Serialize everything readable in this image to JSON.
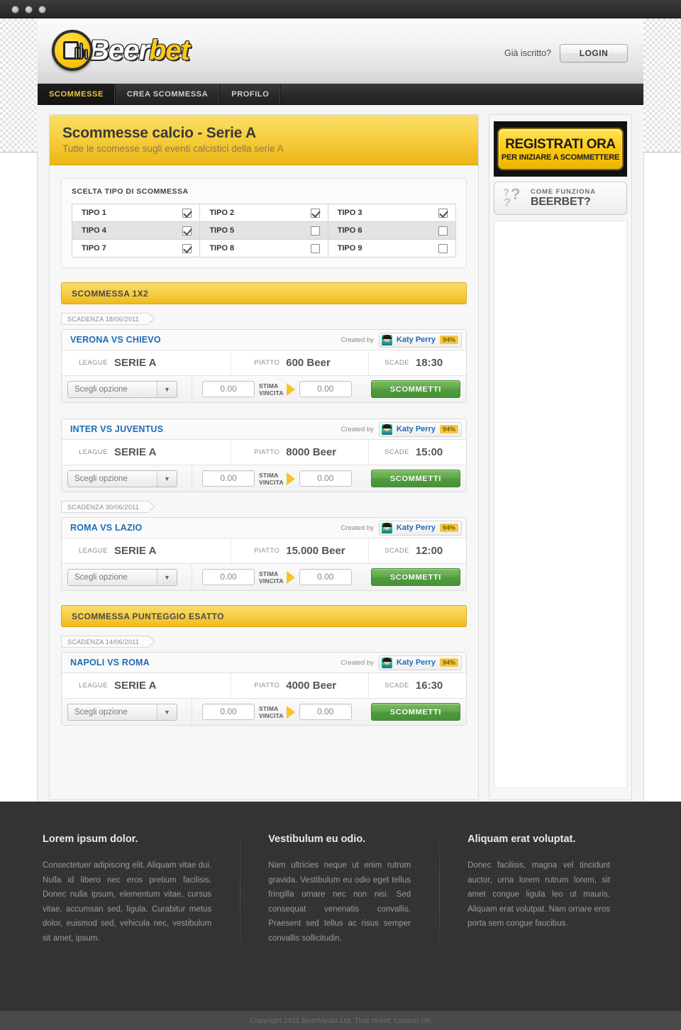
{
  "window": {
    "dots": [
      "close",
      "minimize",
      "zoom"
    ]
  },
  "header": {
    "logo_text_a": "Beer",
    "logo_text_b": "bet",
    "already_member_label": "Già iscritto?",
    "login_label": "LOGIN"
  },
  "nav": {
    "items": [
      {
        "label": "SCOMMESSE",
        "active": true
      },
      {
        "label": "CREA SCOMMESSA",
        "active": false
      },
      {
        "label": "PROFILO",
        "active": false
      }
    ]
  },
  "page": {
    "title": "Scommesse calcio - Serie A",
    "subtitle": "Tutte le scomesse sugli eventi calcistici della serie A"
  },
  "filter": {
    "legend": "SCELTA TIPO DI SCOMMESSA",
    "rows": [
      [
        {
          "label": "TIPO 1",
          "checked": true
        },
        {
          "label": "TIPO 2",
          "checked": true
        },
        {
          "label": "TIPO 3",
          "checked": true
        }
      ],
      [
        {
          "label": "TIPO 4",
          "checked": true
        },
        {
          "label": "TIPO 5",
          "checked": false
        },
        {
          "label": "TIPO 6",
          "checked": false
        }
      ],
      [
        {
          "label": "TIPO 7",
          "checked": true
        },
        {
          "label": "TIPO 8",
          "checked": false
        },
        {
          "label": "TIPO 9",
          "checked": false
        }
      ]
    ]
  },
  "labels": {
    "created_by": "Created by",
    "league": "LEAGUE",
    "piatto": "PIATTO",
    "scade": "SCADE",
    "select_placeholder": "Scegli opzione",
    "stima_line1": "STIMA",
    "stima_line2": "VINCITA",
    "submit": "SCOMMETTI",
    "amount_value": "0.00",
    "payout_value": "0.00"
  },
  "sections": [
    {
      "heading": "SCOMMESSA  1X2",
      "groups": [
        {
          "scadenza": "SCADENZA 18/06/2011",
          "bets": [
            {
              "match": "VERONA VS CHIEVO",
              "creator": "Katy Perry",
              "creator_pct": "94%",
              "league": "SERIE A",
              "piatto": "600 Beer",
              "scade": "18:30"
            },
            {
              "match": "INTER VS JUVENTUS",
              "creator": "Katy Perry",
              "creator_pct": "94%",
              "league": "SERIE A",
              "piatto": "8000 Beer",
              "scade": "15:00"
            }
          ]
        },
        {
          "scadenza": "SCADENZA 30/06/2011",
          "bets": [
            {
              "match": "ROMA VS LAZIO",
              "creator": "Katy Perry",
              "creator_pct": "94%",
              "league": "SERIE A",
              "piatto": "15.000 Beer",
              "scade": "12:00"
            }
          ]
        }
      ]
    },
    {
      "heading": "SCOMMESSA  PUNTEGGIO ESATTO",
      "groups": [
        {
          "scadenza": "SCADENZA 14/06/2011",
          "bets": [
            {
              "match": "NAPOLI VS ROMA",
              "creator": "Katy Perry",
              "creator_pct": "94%",
              "league": "SERIE A",
              "piatto": "4000 Beer",
              "scade": "16:30"
            }
          ]
        }
      ]
    }
  ],
  "sidebar": {
    "promo_line1": "REGISTRATI ORA",
    "promo_line2": "PER INIZIARE A SCOMMETTERE",
    "howto_line1": "COME FUNZIONA",
    "howto_line2": "BEERBET?"
  },
  "footer": {
    "columns": [
      {
        "title": "Lorem ipsum dolor.",
        "text": "Consectetuer adipiscing elit. Aliquam vitae dui. Nulla id libero nec eros pretium facilisis. Donec nulla ipsum, elementum vitae, cursus vitae, accumsan sed, ligula. Curabitur metus dolor, euismod sed, vehicula nec, vestibulum sit amet, ipsum."
      },
      {
        "title": "Vestibulum eu odio.",
        "text": "Nam ultricies neque ut enim rutrum gravida. Vestibulum eu odio eget tellus fringilla ornare nec non nisi. Sed consequat venenatis convallis. Praesent sed tellus ac risus semper convallis sollicitudin."
      },
      {
        "title": "Aliquam erat voluptat.",
        "text": "Donec facilisis, magna vel tincidunt auctor, urna lorem rutrum lorem, sit amet congue ligula leo ut mauris. Aliquam erat volutpat. Nam ornare eros porta sem congue faucibus."
      }
    ],
    "copyright": "Copyright 2011 BeerMedia Ltd, That street, London UK"
  },
  "colors": {
    "accent_yellow": "#f7cf3f",
    "link_blue": "#1e6bb8",
    "submit_green": "#5ca748",
    "footer_bg": "#333333"
  }
}
